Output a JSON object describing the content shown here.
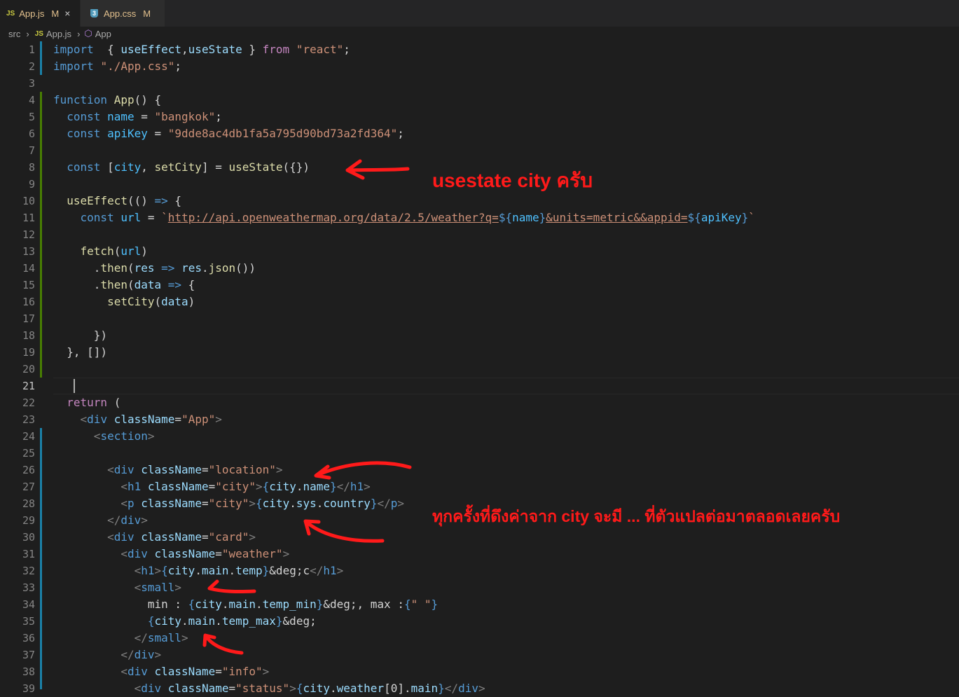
{
  "tabs": [
    {
      "icon": "JS",
      "label": "App.js",
      "status": "M",
      "close": "×"
    },
    {
      "icon": "3",
      "label": "App.css",
      "status": "M"
    }
  ],
  "breadcrumb": {
    "folder": "src",
    "file_icon": "JS",
    "file": "App.js",
    "symbol": "App"
  },
  "current_line": 21,
  "annotations": [
    "usestate city ครับ",
    "ทุกครั้งที่ดึงค่าจาก city จะมี ... ที่ตัวแปลต่อมาตลอดเลยครับ"
  ],
  "lines": [
    {
      "n": 1,
      "code": [
        [
          "kw",
          "import"
        ],
        [
          "",
          "  { "
        ],
        [
          "var",
          "useEffect"
        ],
        [
          "",
          ","
        ],
        [
          "var",
          "useState"
        ],
        [
          "",
          " } "
        ],
        [
          "ctl",
          "from"
        ],
        [
          "",
          " "
        ],
        [
          "str",
          "\"react\""
        ],
        [
          "",
          ";"
        ]
      ]
    },
    {
      "n": 2,
      "code": [
        [
          "kw",
          "import"
        ],
        [
          "",
          " "
        ],
        [
          "str",
          "\"./App.css\""
        ],
        [
          "",
          ";"
        ]
      ]
    },
    {
      "n": 3,
      "code": []
    },
    {
      "n": 4,
      "code": [
        [
          "kw",
          "function"
        ],
        [
          "",
          " "
        ],
        [
          "fn",
          "App"
        ],
        [
          "",
          "() {"
        ]
      ]
    },
    {
      "n": 5,
      "code": [
        [
          "",
          "  "
        ],
        [
          "kw",
          "const"
        ],
        [
          "",
          " "
        ],
        [
          "cst",
          "name"
        ],
        [
          "",
          " = "
        ],
        [
          "str",
          "\"bangkok\""
        ],
        [
          "",
          ";"
        ]
      ]
    },
    {
      "n": 6,
      "code": [
        [
          "",
          "  "
        ],
        [
          "kw",
          "const"
        ],
        [
          "",
          " "
        ],
        [
          "cst",
          "apiKey"
        ],
        [
          "",
          " = "
        ],
        [
          "str",
          "\"9dde8ac4db1fa5a795d90bd73a2fd364\""
        ],
        [
          "",
          ";"
        ]
      ]
    },
    {
      "n": 7,
      "code": []
    },
    {
      "n": 8,
      "code": [
        [
          "",
          "  "
        ],
        [
          "kw",
          "const"
        ],
        [
          "",
          " ["
        ],
        [
          "cst",
          "city"
        ],
        [
          "",
          ", "
        ],
        [
          "fn",
          "setCity"
        ],
        [
          "",
          "] = "
        ],
        [
          "fn",
          "useState"
        ],
        [
          "",
          "({})"
        ]
      ]
    },
    {
      "n": 9,
      "code": []
    },
    {
      "n": 10,
      "code": [
        [
          "",
          "  "
        ],
        [
          "fn",
          "useEffect"
        ],
        [
          "",
          "(() "
        ],
        [
          "kw",
          "=>"
        ],
        [
          "",
          " {"
        ]
      ]
    },
    {
      "n": 11,
      "code": [
        [
          "",
          "    "
        ],
        [
          "kw",
          "const"
        ],
        [
          "",
          " "
        ],
        [
          "cst",
          "url"
        ],
        [
          "",
          " = "
        ],
        [
          "str",
          "`"
        ],
        [
          "url",
          "http://api.openweathermap.org/data/2.5/weather?q="
        ],
        [
          "kw",
          "${"
        ],
        [
          "cst",
          "name"
        ],
        [
          "kw",
          "}"
        ],
        [
          "url",
          "&units=metric&&appid="
        ],
        [
          "kw",
          "${"
        ],
        [
          "cst",
          "apiKey"
        ],
        [
          "kw",
          "}"
        ],
        [
          "str",
          "`"
        ]
      ]
    },
    {
      "n": 12,
      "code": []
    },
    {
      "n": 13,
      "code": [
        [
          "",
          "    "
        ],
        [
          "fn",
          "fetch"
        ],
        [
          "",
          "("
        ],
        [
          "cst",
          "url"
        ],
        [
          "",
          ")"
        ]
      ]
    },
    {
      "n": 14,
      "code": [
        [
          "",
          "      ."
        ],
        [
          "fn",
          "then"
        ],
        [
          "",
          "("
        ],
        [
          "var",
          "res"
        ],
        [
          "",
          " "
        ],
        [
          "kw",
          "=>"
        ],
        [
          "",
          " "
        ],
        [
          "var",
          "res"
        ],
        [
          "",
          "."
        ],
        [
          "fn",
          "json"
        ],
        [
          "",
          "())"
        ]
      ]
    },
    {
      "n": 15,
      "code": [
        [
          "",
          "      ."
        ],
        [
          "fn",
          "then"
        ],
        [
          "",
          "("
        ],
        [
          "var",
          "data"
        ],
        [
          "",
          " "
        ],
        [
          "kw",
          "=>"
        ],
        [
          "",
          " {"
        ]
      ]
    },
    {
      "n": 16,
      "code": [
        [
          "",
          "        "
        ],
        [
          "fn",
          "setCity"
        ],
        [
          "",
          "("
        ],
        [
          "var",
          "data"
        ],
        [
          "",
          ")"
        ]
      ]
    },
    {
      "n": 17,
      "code": []
    },
    {
      "n": 18,
      "code": [
        [
          "",
          "      })"
        ]
      ]
    },
    {
      "n": 19,
      "code": [
        [
          "",
          "  }, [])"
        ]
      ]
    },
    {
      "n": 20,
      "code": []
    },
    {
      "n": 21,
      "code": []
    },
    {
      "n": 22,
      "code": [
        [
          "",
          "  "
        ],
        [
          "ctl",
          "return"
        ],
        [
          "",
          " ("
        ]
      ]
    },
    {
      "n": 23,
      "code": [
        [
          "",
          "    "
        ],
        [
          "tag",
          "<"
        ],
        [
          "tn",
          "div"
        ],
        [
          "",
          " "
        ],
        [
          "at",
          "className"
        ],
        [
          "",
          "="
        ],
        [
          "str",
          "\"App\""
        ],
        [
          "tag",
          ">"
        ]
      ]
    },
    {
      "n": 24,
      "code": [
        [
          "",
          "      "
        ],
        [
          "tag",
          "<"
        ],
        [
          "tn",
          "section"
        ],
        [
          "tag",
          ">"
        ]
      ]
    },
    {
      "n": 25,
      "code": []
    },
    {
      "n": 26,
      "code": [
        [
          "",
          "        "
        ],
        [
          "tag",
          "<"
        ],
        [
          "tn",
          "div"
        ],
        [
          "",
          " "
        ],
        [
          "at",
          "className"
        ],
        [
          "",
          "="
        ],
        [
          "str",
          "\"location\""
        ],
        [
          "tag",
          ">"
        ]
      ]
    },
    {
      "n": 27,
      "code": [
        [
          "",
          "          "
        ],
        [
          "tag",
          "<"
        ],
        [
          "tn",
          "h1"
        ],
        [
          "",
          " "
        ],
        [
          "at",
          "className"
        ],
        [
          "",
          "="
        ],
        [
          "str",
          "\"city\""
        ],
        [
          "tag",
          ">"
        ],
        [
          "kw",
          "{"
        ],
        [
          "var",
          "city"
        ],
        [
          "",
          "."
        ],
        [
          "var",
          "name"
        ],
        [
          "kw",
          "}"
        ],
        [
          "tag",
          "</"
        ],
        [
          "tn",
          "h1"
        ],
        [
          "tag",
          ">"
        ]
      ]
    },
    {
      "n": 28,
      "code": [
        [
          "",
          "          "
        ],
        [
          "tag",
          "<"
        ],
        [
          "tn",
          "p"
        ],
        [
          "",
          " "
        ],
        [
          "at",
          "className"
        ],
        [
          "",
          "="
        ],
        [
          "str",
          "\"city\""
        ],
        [
          "tag",
          ">"
        ],
        [
          "kw",
          "{"
        ],
        [
          "var",
          "city"
        ],
        [
          "",
          "."
        ],
        [
          "var",
          "sys"
        ],
        [
          "",
          "."
        ],
        [
          "var",
          "country"
        ],
        [
          "kw",
          "}"
        ],
        [
          "tag",
          "</"
        ],
        [
          "tn",
          "p"
        ],
        [
          "tag",
          ">"
        ]
      ]
    },
    {
      "n": 29,
      "code": [
        [
          "",
          "        "
        ],
        [
          "tag",
          "</"
        ],
        [
          "tn",
          "div"
        ],
        [
          "tag",
          ">"
        ]
      ]
    },
    {
      "n": 30,
      "code": [
        [
          "",
          "        "
        ],
        [
          "tag",
          "<"
        ],
        [
          "tn",
          "div"
        ],
        [
          "",
          " "
        ],
        [
          "at",
          "className"
        ],
        [
          "",
          "="
        ],
        [
          "str",
          "\"card\""
        ],
        [
          "tag",
          ">"
        ]
      ]
    },
    {
      "n": 31,
      "code": [
        [
          "",
          "          "
        ],
        [
          "tag",
          "<"
        ],
        [
          "tn",
          "div"
        ],
        [
          "",
          " "
        ],
        [
          "at",
          "className"
        ],
        [
          "",
          "="
        ],
        [
          "str",
          "\"weather\""
        ],
        [
          "tag",
          ">"
        ]
      ]
    },
    {
      "n": 32,
      "code": [
        [
          "",
          "            "
        ],
        [
          "tag",
          "<"
        ],
        [
          "tn",
          "h1"
        ],
        [
          "tag",
          ">"
        ],
        [
          "kw",
          "{"
        ],
        [
          "var",
          "city"
        ],
        [
          "",
          "."
        ],
        [
          "var",
          "main"
        ],
        [
          "",
          "."
        ],
        [
          "var",
          "temp"
        ],
        [
          "kw",
          "}"
        ],
        [
          "ent",
          "&deg;"
        ],
        [
          "",
          "c"
        ],
        [
          "tag",
          "</"
        ],
        [
          "tn",
          "h1"
        ],
        [
          "tag",
          ">"
        ]
      ]
    },
    {
      "n": 33,
      "code": [
        [
          "",
          "            "
        ],
        [
          "tag",
          "<"
        ],
        [
          "tn",
          "small"
        ],
        [
          "tag",
          ">"
        ]
      ]
    },
    {
      "n": 34,
      "code": [
        [
          "",
          "              min : "
        ],
        [
          "kw",
          "{"
        ],
        [
          "var",
          "city"
        ],
        [
          "",
          "."
        ],
        [
          "var",
          "main"
        ],
        [
          "",
          "."
        ],
        [
          "var",
          "temp_min"
        ],
        [
          "kw",
          "}"
        ],
        [
          "ent",
          "&deg;"
        ],
        [
          "",
          ", max :"
        ],
        [
          "kw",
          "{"
        ],
        [
          "str",
          "\" \""
        ],
        [
          "kw",
          "}"
        ]
      ]
    },
    {
      "n": 35,
      "code": [
        [
          "",
          "              "
        ],
        [
          "kw",
          "{"
        ],
        [
          "var",
          "city"
        ],
        [
          "",
          "."
        ],
        [
          "var",
          "main"
        ],
        [
          "",
          "."
        ],
        [
          "var",
          "temp_max"
        ],
        [
          "kw",
          "}"
        ],
        [
          "ent",
          "&deg;"
        ]
      ]
    },
    {
      "n": 36,
      "code": [
        [
          "",
          "            "
        ],
        [
          "tag",
          "</"
        ],
        [
          "tn",
          "small"
        ],
        [
          "tag",
          ">"
        ]
      ]
    },
    {
      "n": 37,
      "code": [
        [
          "",
          "          "
        ],
        [
          "tag",
          "</"
        ],
        [
          "tn",
          "div"
        ],
        [
          "tag",
          ">"
        ]
      ]
    },
    {
      "n": 38,
      "code": [
        [
          "",
          "          "
        ],
        [
          "tag",
          "<"
        ],
        [
          "tn",
          "div"
        ],
        [
          "",
          " "
        ],
        [
          "at",
          "className"
        ],
        [
          "",
          "="
        ],
        [
          "str",
          "\"info\""
        ],
        [
          "tag",
          ">"
        ]
      ]
    },
    {
      "n": 39,
      "code": [
        [
          "",
          "            "
        ],
        [
          "tag",
          "<"
        ],
        [
          "tn",
          "div"
        ],
        [
          "",
          " "
        ],
        [
          "at",
          "className"
        ],
        [
          "",
          "="
        ],
        [
          "str",
          "\"status\""
        ],
        [
          "tag",
          ">"
        ],
        [
          "kw",
          "{"
        ],
        [
          "var",
          "city"
        ],
        [
          "",
          "."
        ],
        [
          "var",
          "weather"
        ],
        [
          "",
          "["
        ],
        [
          "",
          "0"
        ],
        [
          "",
          "]."
        ],
        [
          "var",
          "main"
        ],
        [
          "kw",
          "}"
        ],
        [
          "tag",
          "</"
        ],
        [
          "tn",
          "div"
        ],
        [
          "tag",
          ">"
        ]
      ]
    }
  ]
}
